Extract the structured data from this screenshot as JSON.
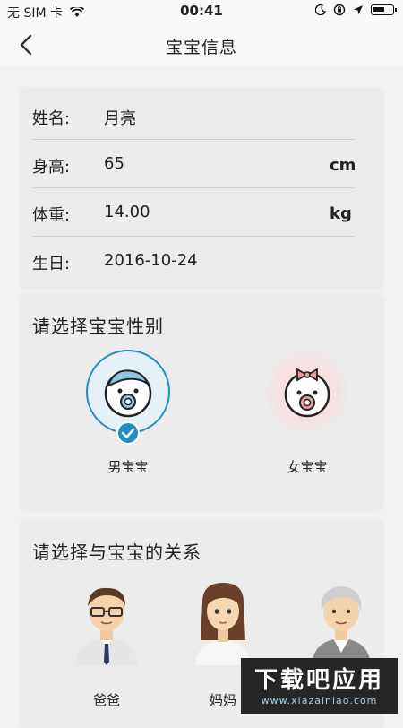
{
  "status_bar": {
    "carrier": "无 SIM 卡",
    "time": "00:41",
    "icons": [
      "wifi-icon",
      "moon-icon",
      "lock-rotation-icon",
      "location-icon",
      "battery-icon"
    ]
  },
  "nav": {
    "title": "宝宝信息",
    "back_icon": "chevron-left-icon"
  },
  "info": {
    "rows": [
      {
        "label": "姓名:",
        "value": "月亮",
        "unit": ""
      },
      {
        "label": "身高:",
        "value": "65",
        "unit": "cm"
      },
      {
        "label": "体重:",
        "value": "14.00",
        "unit": "kg"
      },
      {
        "label": "生日:",
        "value": "2016-10-24",
        "unit": ""
      }
    ]
  },
  "gender": {
    "title": "请选择宝宝性别",
    "options": [
      {
        "label": "男宝宝",
        "selected": true,
        "icon": "baby-boy-icon"
      },
      {
        "label": "女宝宝",
        "selected": false,
        "icon": "baby-girl-icon"
      }
    ]
  },
  "relation": {
    "title": "请选择与宝宝的关系",
    "options": [
      {
        "label": "爸爸",
        "icon": "father-avatar-icon"
      },
      {
        "label": "妈妈",
        "icon": "mother-avatar-icon"
      },
      {
        "label": "",
        "icon": "grandpa-avatar-icon"
      }
    ]
  },
  "watermark": {
    "main": "下载吧应用",
    "sub": "www.xiazainiao.com"
  },
  "colors": {
    "accent": "#1e8fc8",
    "card": "#ececec",
    "background": "#f2f2f2"
  }
}
